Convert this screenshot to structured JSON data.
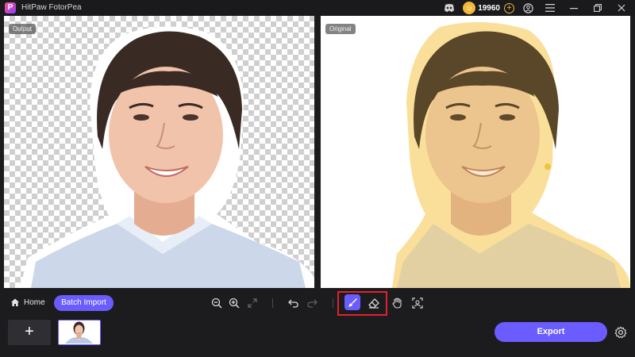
{
  "app": {
    "title": "HitPaw FotorPea",
    "logo_letter": "P"
  },
  "header": {
    "credits": "19960",
    "credit_badge": "☺",
    "credit_plus": "+"
  },
  "panels": {
    "output_label": "Output",
    "original_label": "Original"
  },
  "toolbar": {
    "home_label": "Home",
    "batch_import_label": "Batch Import"
  },
  "bottom": {
    "add_label": "+",
    "export_label": "Export"
  },
  "colors": {
    "accent": "#6a5cff",
    "selection_overlay": "#f5c957",
    "highlight_box": "#e0222b",
    "coin": "#f2b93b"
  },
  "icons": [
    "discord-icon",
    "coin-icon",
    "account-icon",
    "menu-icon",
    "minimize-icon",
    "restore-icon",
    "close-icon",
    "home-icon",
    "zoom-out-icon",
    "zoom-in-icon",
    "fit-screen-icon",
    "undo-icon",
    "redo-icon",
    "brush-icon",
    "eraser-icon",
    "hand-icon",
    "compare-icon",
    "settings-icon"
  ]
}
